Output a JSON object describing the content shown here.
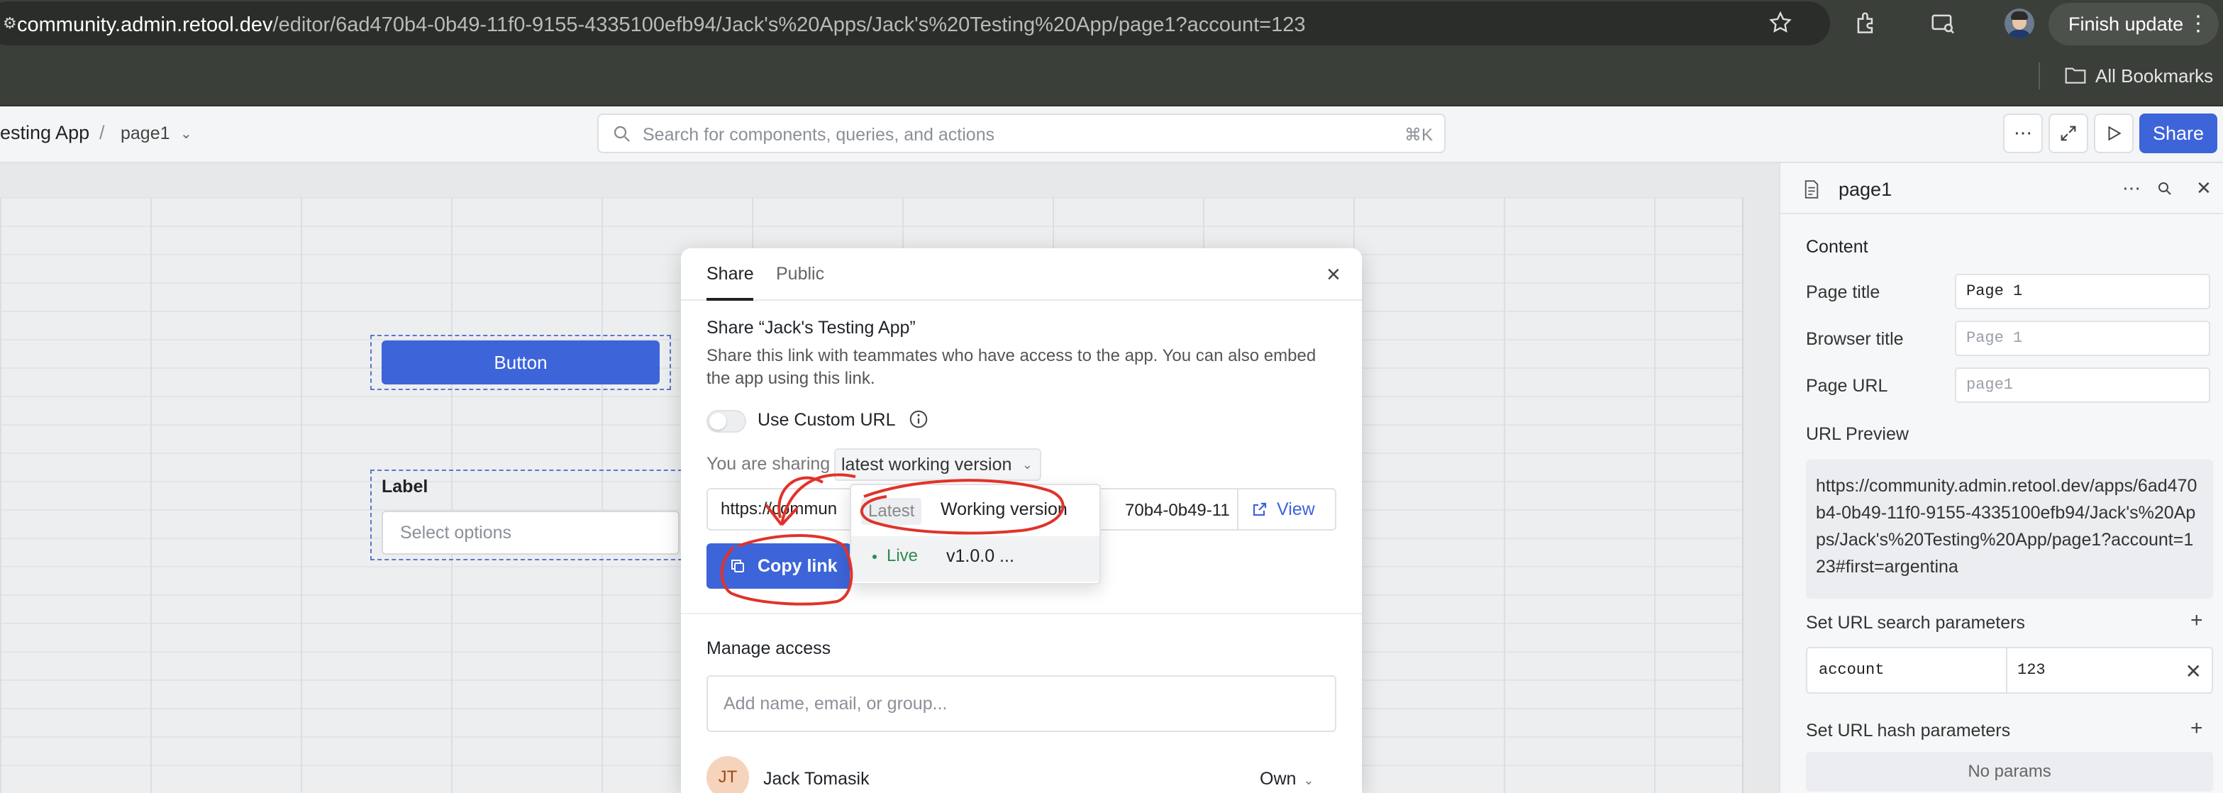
{
  "browser": {
    "url_host": "community.admin.retool.dev",
    "url_path": "/editor/6ad470b4-0b49-11f0-9155-4335100efb94/Jack's%20Apps/Jack's%20Testing%20App/page1?account=123",
    "finish_update": "Finish update",
    "bookmarks_label": "All Bookmarks"
  },
  "header": {
    "app_name": "esting App",
    "separator": "/",
    "page": "page1",
    "search_placeholder": "Search for components, queries, and actions",
    "search_shortcut": "⌘K",
    "share_label": "Share"
  },
  "canvas": {
    "button_label": "Button",
    "select_label": "Label",
    "select_placeholder": "Select options"
  },
  "inspector": {
    "title": "page1",
    "content_heading": "Content",
    "page_title_label": "Page title",
    "page_title_value": "Page 1",
    "browser_title_label": "Browser title",
    "browser_title_placeholder": "Page 1",
    "page_url_label": "Page URL",
    "page_url_placeholder": "page1",
    "url_preview_label": "URL Preview",
    "url_preview_value": "https://community.admin.retool.dev/apps/6ad470b4-0b49-11f0-9155-4335100efb94/Jack's%20Apps/Jack's%20Testing%20App/page1?account=123#first=argentina",
    "search_params_label": "Set URL search parameters",
    "param_key": "account",
    "param_value": "123",
    "hash_params_label": "Set URL hash parameters",
    "no_params": "No params"
  },
  "modal": {
    "tab_share": "Share",
    "tab_public": "Public",
    "title": "Share “Jack's Testing App”",
    "description": "Share this link with teammates who have access to the app. You can also embed the app using this link.",
    "custom_url_label": "Use Custom URL",
    "sharing_label": "You are sharing",
    "sharing_value": "latest working version",
    "link_value_start": "https://commun",
    "link_value_end": "70b4-0b49-11",
    "view_label": "View",
    "copy_label": "Copy link",
    "manage_access": "Manage access",
    "invite_placeholder": "Add name, email, or group...",
    "user_initials": "JT",
    "user_name": "Jack Tomasik",
    "user_role": "Own"
  },
  "version_menu": {
    "latest_badge": "Latest",
    "working_label": "Working version",
    "live_badge": "Live",
    "version_label": "v1.0.0 ..."
  },
  "colors": {
    "accent": "#3d64d9",
    "annotation": "#e0332a",
    "live": "#2e8b4e"
  }
}
